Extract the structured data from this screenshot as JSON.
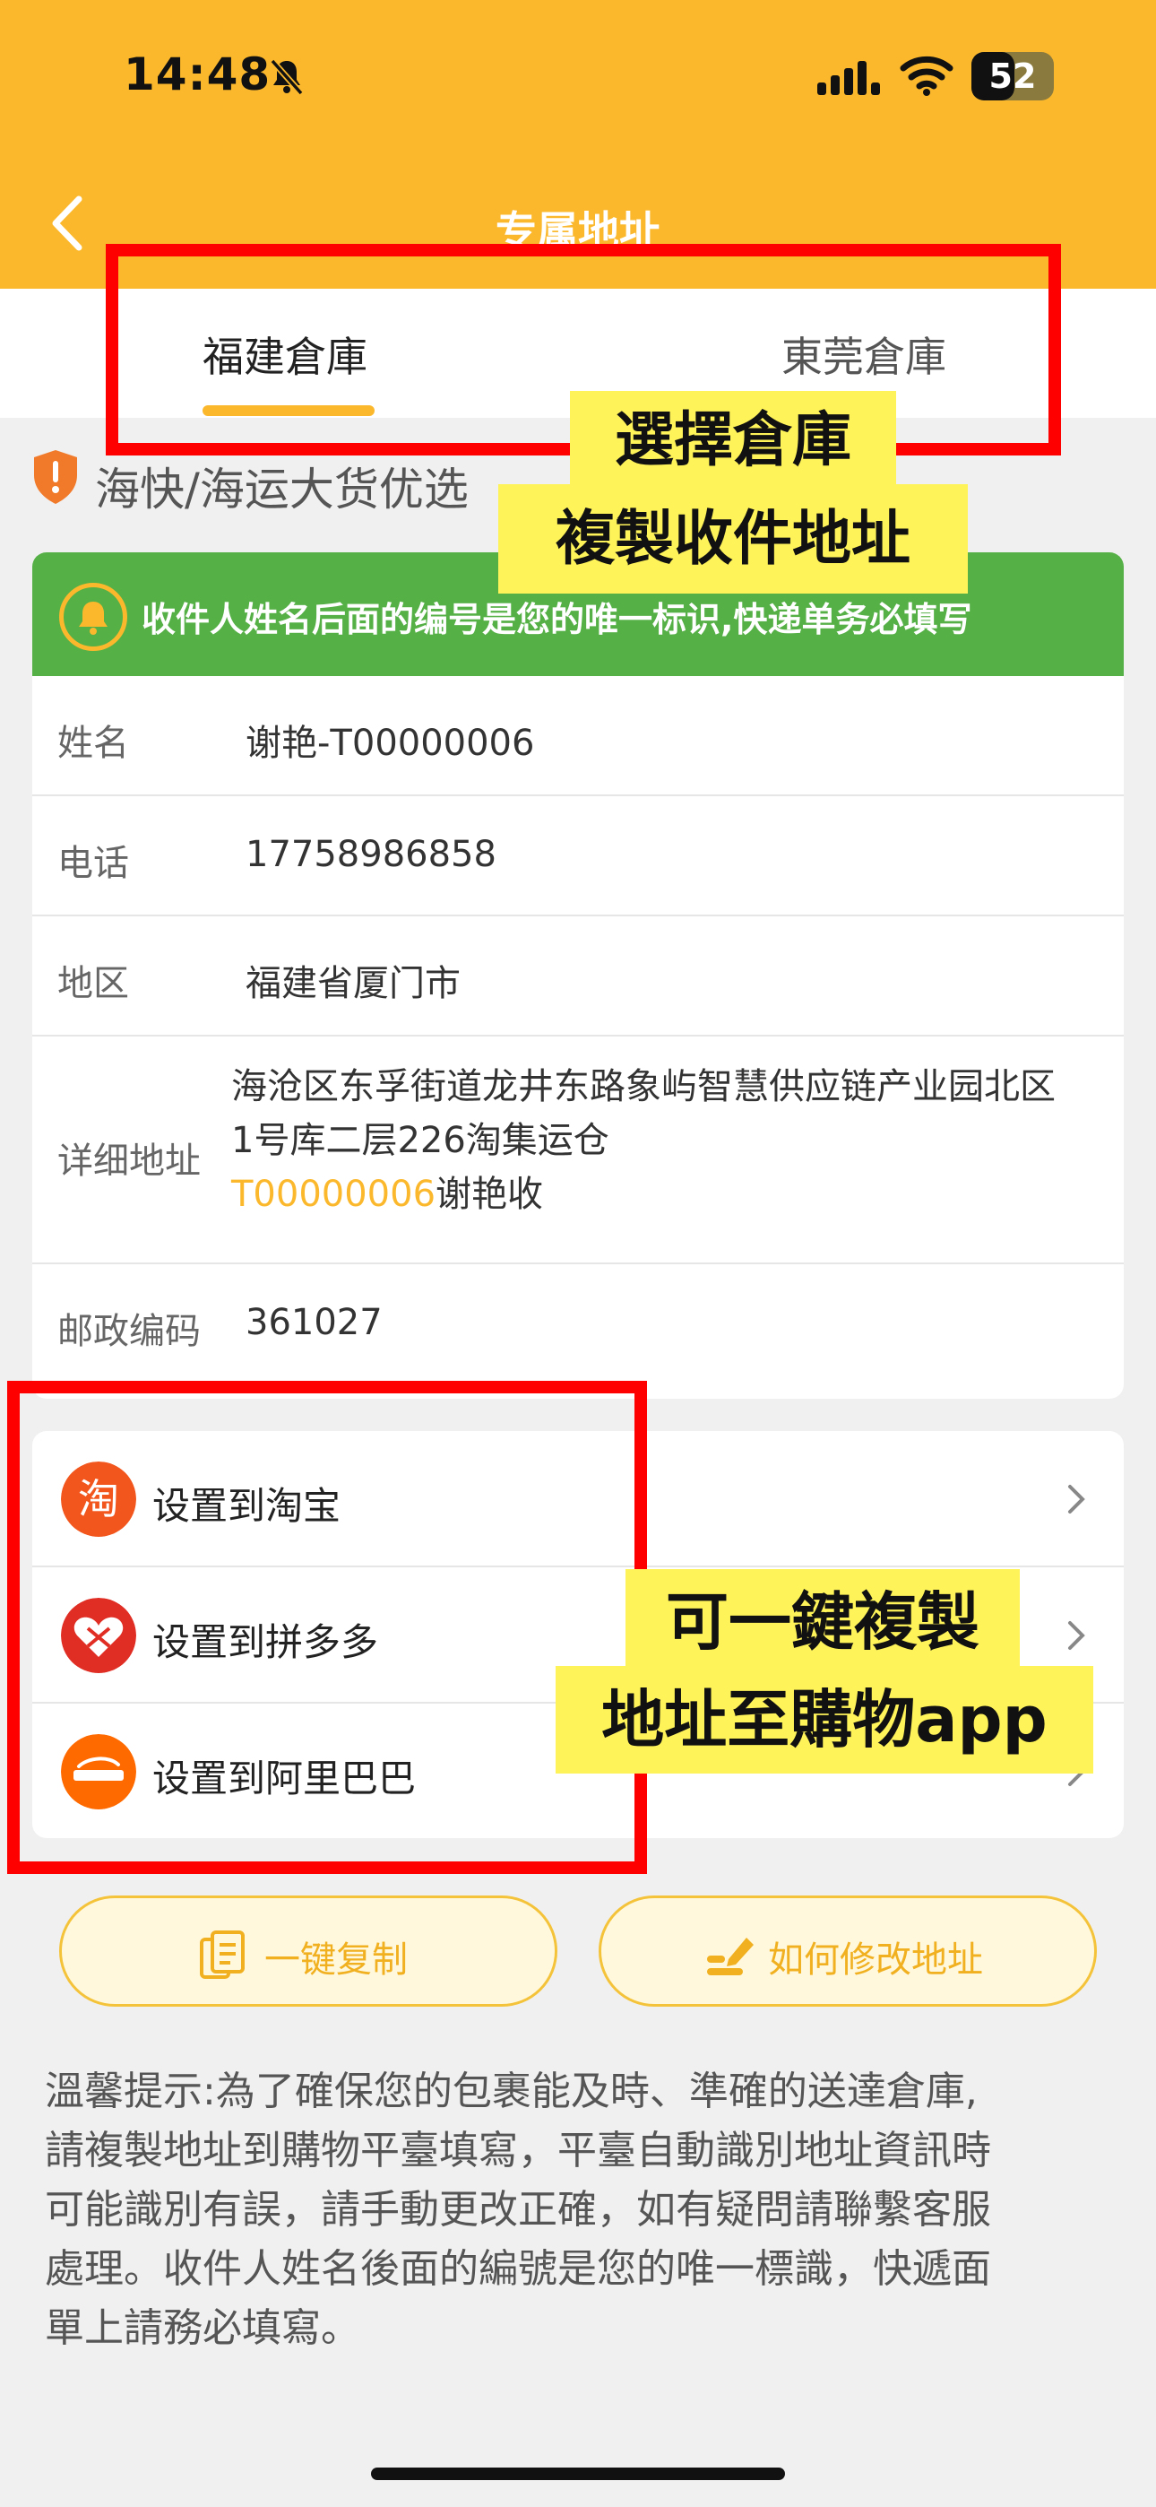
{
  "status_bar": {
    "time": "14:48",
    "battery": "52",
    "battery_level": 0.52
  },
  "header": {
    "title": "专属地址"
  },
  "tabs": [
    {
      "label": "福建倉庫",
      "active": true
    },
    {
      "label": "東莞倉庫",
      "active": false
    }
  ],
  "section": {
    "label": "海快/海运大货优选"
  },
  "info": {
    "banner": "收件人姓名后面的编号是您的唯一标识,快递单务必填写",
    "name_label": "姓名",
    "name_value": "谢艳-T00000006",
    "phone_label": "电话",
    "phone_value": "17758986858",
    "region_label": "地区",
    "region_value": "福建省厦门市",
    "address_label": "详细地址",
    "address_line1": "海沧区东孚街道龙井东路象屿智慧供应链产业园北区",
    "address_line2": "1号库二层226淘集运仓",
    "address_code": "T00000006",
    "address_suffix": "谢艳收",
    "postal_label": "邮政编码",
    "postal_value": "361027"
  },
  "apps": [
    {
      "label": "设置到淘宝",
      "icon": "taobao-icon",
      "color": "#f2561d"
    },
    {
      "label": "设置到拼多多",
      "icon": "pinduoduo-icon",
      "color": "#e02e24"
    },
    {
      "label": "设置到阿里巴巴",
      "icon": "alibaba-icon",
      "color": "#ff6a00"
    }
  ],
  "buttons": {
    "copy_all": "一键复制",
    "how_to_edit": "如何修改地址"
  },
  "notice": {
    "line1": "溫馨提示:為了確保您的包裹能及時、準確的送達倉庫,",
    "line2": "請複製地址到購物平臺填寫，平臺自動識別地址資訊時",
    "line3": "可能識別有誤，請手動更改正確，如有疑問請聯繫客服",
    "line4": "處理。收件人姓名後面的編號是您的唯一標識，快遞面",
    "line5": "單上請務必填寫。"
  },
  "annotations": {
    "callout1_line1": "選擇倉庫",
    "callout1_line2": "複製收件地址",
    "callout2_line1": "可一鍵複製",
    "callout2_line2": "地址至購物app"
  },
  "colors": {
    "brand": "#fbb82c",
    "banner": "#55b046",
    "highlight": "#ff0000",
    "callout": "#fff35a"
  }
}
